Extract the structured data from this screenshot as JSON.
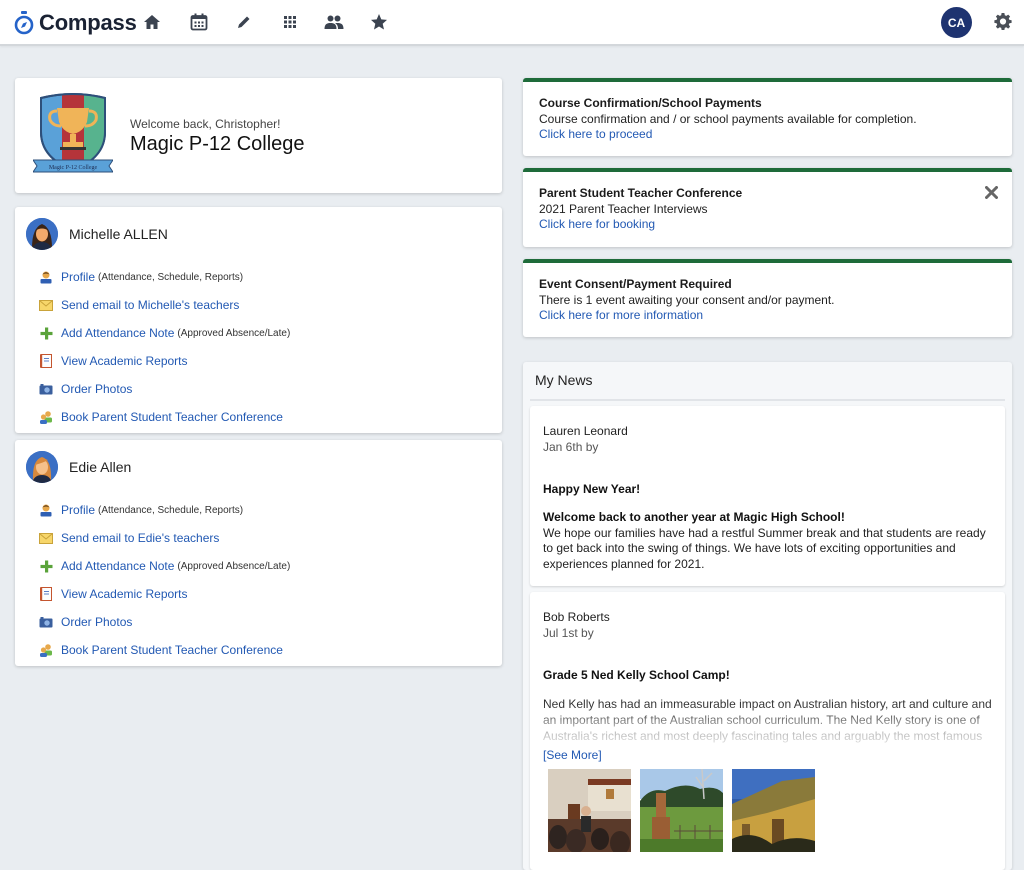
{
  "app": {
    "name": "Compass"
  },
  "navbar": {
    "icons": [
      "home-icon",
      "calendar-icon",
      "pencil-icon",
      "apps-grid-icon",
      "people-icon",
      "star-icon"
    ],
    "user_initials": "CA",
    "user_avatar_color": "#1e3370",
    "settings_icon": "gear-icon"
  },
  "school": {
    "welcome": "Welcome back, Christopher!",
    "name": "Magic P-12 College",
    "crest_ribbon": "Magic P-12 College"
  },
  "students": [
    {
      "name": "Michelle ALLEN",
      "actions": [
        {
          "icon": "profile-icon",
          "label": "Profile",
          "sub": "(Attendance, Schedule, Reports)"
        },
        {
          "icon": "email-icon",
          "label": "Send email to Michelle's teachers",
          "sub": ""
        },
        {
          "icon": "plus-icon",
          "label": "Add Attendance Note",
          "sub": "(Approved Absence/Late)"
        },
        {
          "icon": "report-icon",
          "label": "View Academic Reports",
          "sub": ""
        },
        {
          "icon": "camera-icon",
          "label": "Order Photos",
          "sub": ""
        },
        {
          "icon": "conference-icon",
          "label": "Book Parent Student Teacher Conference",
          "sub": ""
        }
      ]
    },
    {
      "name": "Edie Allen",
      "actions": [
        {
          "icon": "profile-icon",
          "label": "Profile",
          "sub": "(Attendance, Schedule, Reports)"
        },
        {
          "icon": "email-icon",
          "label": "Send email to Edie's teachers",
          "sub": ""
        },
        {
          "icon": "plus-icon",
          "label": "Add Attendance Note",
          "sub": "(Approved Absence/Late)"
        },
        {
          "icon": "report-icon",
          "label": "View Academic Reports",
          "sub": ""
        },
        {
          "icon": "camera-icon",
          "label": "Order Photos",
          "sub": ""
        },
        {
          "icon": "conference-icon",
          "label": "Book Parent Student Teacher Conference",
          "sub": ""
        }
      ]
    }
  ],
  "alerts": [
    {
      "title": "Course Confirmation/School Payments",
      "text": "Course confirmation and / or school payments available for completion.",
      "link": "Click here to proceed",
      "dismissible": false
    },
    {
      "title": "Parent Student Teacher Conference",
      "text": "2021 Parent Teacher Interviews",
      "link": "Click here for booking",
      "dismissible": true
    },
    {
      "title": "Event Consent/Payment Required",
      "text": "There is 1 event awaiting your consent and/or payment.",
      "link": "Click here for more information",
      "dismissible": false
    }
  ],
  "alert_accent": "#1e6b3a",
  "news": {
    "heading": "My News",
    "items": [
      {
        "author": "Lauren Leonard",
        "date": "Jan 6th by",
        "title": "Happy New Year!",
        "body_bold": "Welcome back to another year at Magic High School!",
        "body": "We hope our families have had a restful Summer break and that students are ready to get back into the swing of things. We have lots of exciting opportunities and experiences planned for 2021."
      },
      {
        "author": "Bob Roberts",
        "date": "Jul 1st by",
        "title": "Grade 5 Ned Kelly School Camp!",
        "body": "Ned Kelly has had an immeasurable impact on Australian history, art and culture and an important part of the Australian school curriculum. The Ned Kelly story is one of Australia's richest and most deeply fascinating tales and arguably the most famous story",
        "see_more": "[See More]",
        "photos": [
          "classroom-photo",
          "landscape-chimney-photo",
          "old-hut-photo"
        ]
      }
    ]
  }
}
